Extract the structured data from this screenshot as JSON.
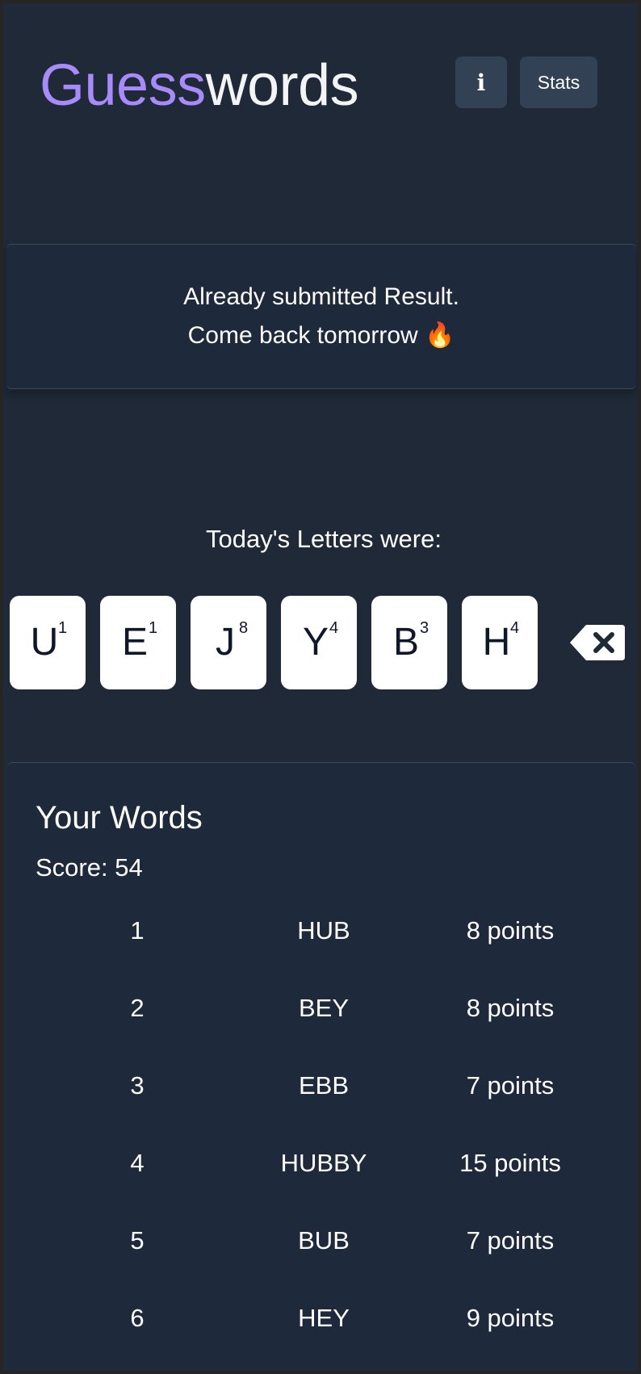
{
  "header": {
    "logo_accent": "Guess",
    "logo_rest": "words",
    "info_label": "i",
    "stats_label": "Stats"
  },
  "result": {
    "line1": "Already submitted Result.",
    "line2": "Come back tomorrow 🔥"
  },
  "letters": {
    "title": "Today's Letters were:",
    "tiles": [
      {
        "letter": "U",
        "score": "1"
      },
      {
        "letter": "E",
        "score": "1"
      },
      {
        "letter": "J",
        "score": "8"
      },
      {
        "letter": "Y",
        "score": "4"
      },
      {
        "letter": "B",
        "score": "3"
      },
      {
        "letter": "H",
        "score": "4"
      }
    ],
    "backspace_icon": "backspace-icon"
  },
  "words": {
    "title": "Your Words",
    "score_label": "Score: 54",
    "rows": [
      {
        "index": "1",
        "word": "HUB",
        "points": "8 points"
      },
      {
        "index": "2",
        "word": "BEY",
        "points": "8 points"
      },
      {
        "index": "3",
        "word": "EBB",
        "points": "7 points"
      },
      {
        "index": "4",
        "word": "HUBBY",
        "points": "15 points"
      },
      {
        "index": "5",
        "word": "BUB",
        "points": "7 points"
      },
      {
        "index": "6",
        "word": "HEY",
        "points": "9 points"
      }
    ]
  },
  "colors": {
    "background": "#1f2937",
    "panel": "#1e293b",
    "accent": "#a78bfa",
    "button": "#334155",
    "tile": "#ffffff"
  }
}
